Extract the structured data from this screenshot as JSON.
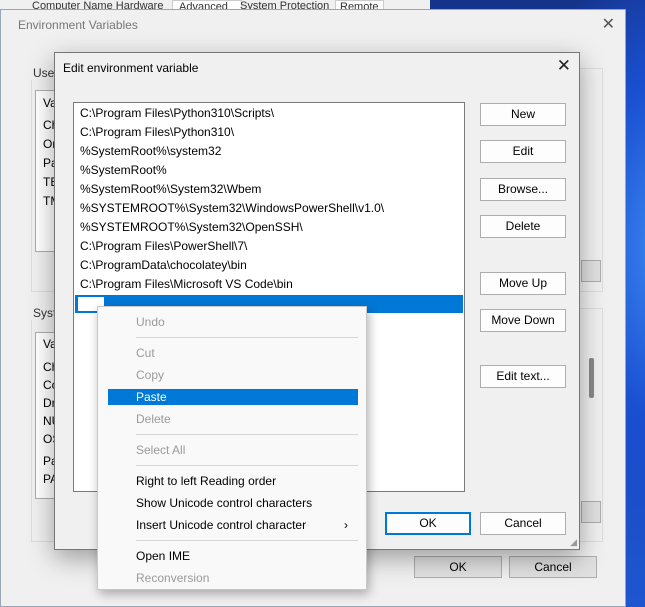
{
  "system_properties": {
    "tabs": [
      "Computer Name",
      "Hardware",
      "Advanced",
      "System Protection",
      "Remote"
    ]
  },
  "env_window": {
    "title": "Environment Variables",
    "user_group_label": "User variables for user",
    "system_group_label": "System variables",
    "user_list_visible": [
      "Va",
      "Ch",
      "On",
      "Pa",
      "TE",
      "TM"
    ],
    "system_list_visible": [
      "Va",
      "Ch",
      "Co",
      "Dr",
      "NU",
      "OS",
      "Pa",
      "PA"
    ],
    "ok_label": "OK",
    "cancel_label": "Cancel"
  },
  "edit_dialog": {
    "title": "Edit environment variable",
    "paths": [
      "C:\\Program Files\\Python310\\Scripts\\",
      "C:\\Program Files\\Python310\\",
      "%SystemRoot%\\system32",
      "%SystemRoot%",
      "%SystemRoot%\\System32\\Wbem",
      "%SYSTEMROOT%\\System32\\WindowsPowerShell\\v1.0\\",
      "%SYSTEMROOT%\\System32\\OpenSSH\\",
      "C:\\Program Files\\PowerShell\\7\\",
      "C:\\ProgramData\\chocolatey\\bin",
      "C:\\Program Files\\Microsoft VS Code\\bin"
    ],
    "buttons": {
      "new": "New",
      "edit": "Edit",
      "browse": "Browse...",
      "delete": "Delete",
      "move_up": "Move Up",
      "move_down": "Move Down",
      "edit_text": "Edit text...",
      "ok": "OK",
      "cancel": "Cancel"
    }
  },
  "context_menu": {
    "undo": "Undo",
    "cut": "Cut",
    "copy": "Copy",
    "paste": "Paste",
    "delete": "Delete",
    "select_all": "Select All",
    "rtl": "Right to left Reading order",
    "show_unicode": "Show Unicode control characters",
    "insert_unicode": "Insert Unicode control character",
    "open_ime": "Open IME",
    "reconversion": "Reconversion"
  },
  "colors": {
    "accent": "#0078d7",
    "dialog_bg": "#f0f0f0"
  }
}
